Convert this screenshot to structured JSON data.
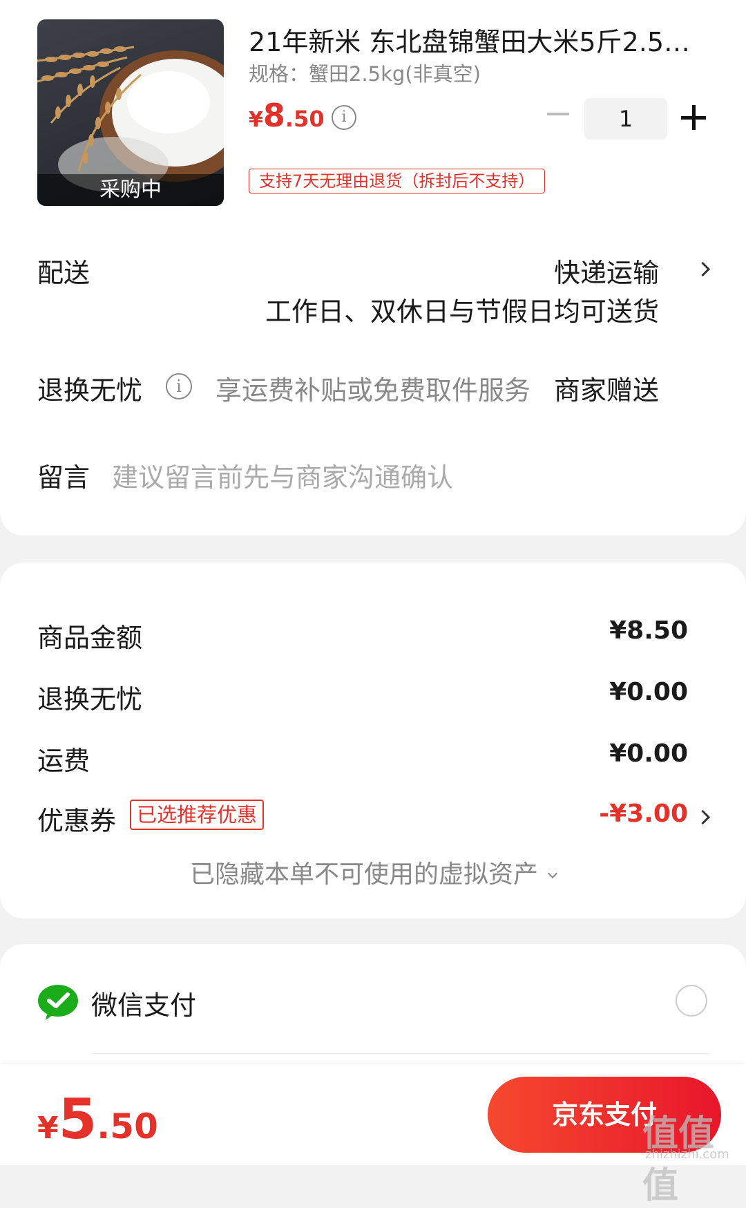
{
  "product": {
    "title": "21年新米 东北盘锦蟹田大米5斤2.5k…",
    "spec": "规格：蟹田2.5kg(非真空)",
    "price_currency": "¥",
    "price_int": "8",
    "price_dec": ".50",
    "status": "采购中",
    "quantity": "1",
    "return_tag": "支持7天无理由退货（拆封后不支持）"
  },
  "delivery": {
    "label": "配送",
    "method": "快递运输",
    "note": "工作日、双休日与节假日均可送货"
  },
  "worry_free": {
    "label": "退换无忧",
    "desc": "享运费补贴或免费取件服务",
    "gift": "商家赠送"
  },
  "message": {
    "label": "留言",
    "placeholder": "建议留言前先与商家沟通确认"
  },
  "summary": {
    "goods_label": "商品金额",
    "goods_value": "¥8.50",
    "worry_label": "退换无忧",
    "worry_value": "¥0.00",
    "shipping_label": "运费",
    "shipping_value": "¥0.00",
    "coupon_label": "优惠券",
    "coupon_tag": "已选推荐优惠",
    "coupon_value": "-¥3.00",
    "hidden_assets": "已隐藏本单不可使用的虚拟资产"
  },
  "payment": {
    "wechat_label": "微信支付"
  },
  "bottom": {
    "total_currency": "¥",
    "total_int": "5",
    "total_dec": ".50",
    "pay_button": "京东支付",
    "watermark": "值值值",
    "watermark_sub": "zhizhizhi.com"
  },
  "colors": {
    "accent_red": "#e4322b",
    "wechat_green": "#1aad19"
  },
  "icons": [
    "info-icon",
    "chevron-right-icon",
    "chevron-down-icon",
    "wechat-icon",
    "minus-icon",
    "plus-icon"
  ]
}
